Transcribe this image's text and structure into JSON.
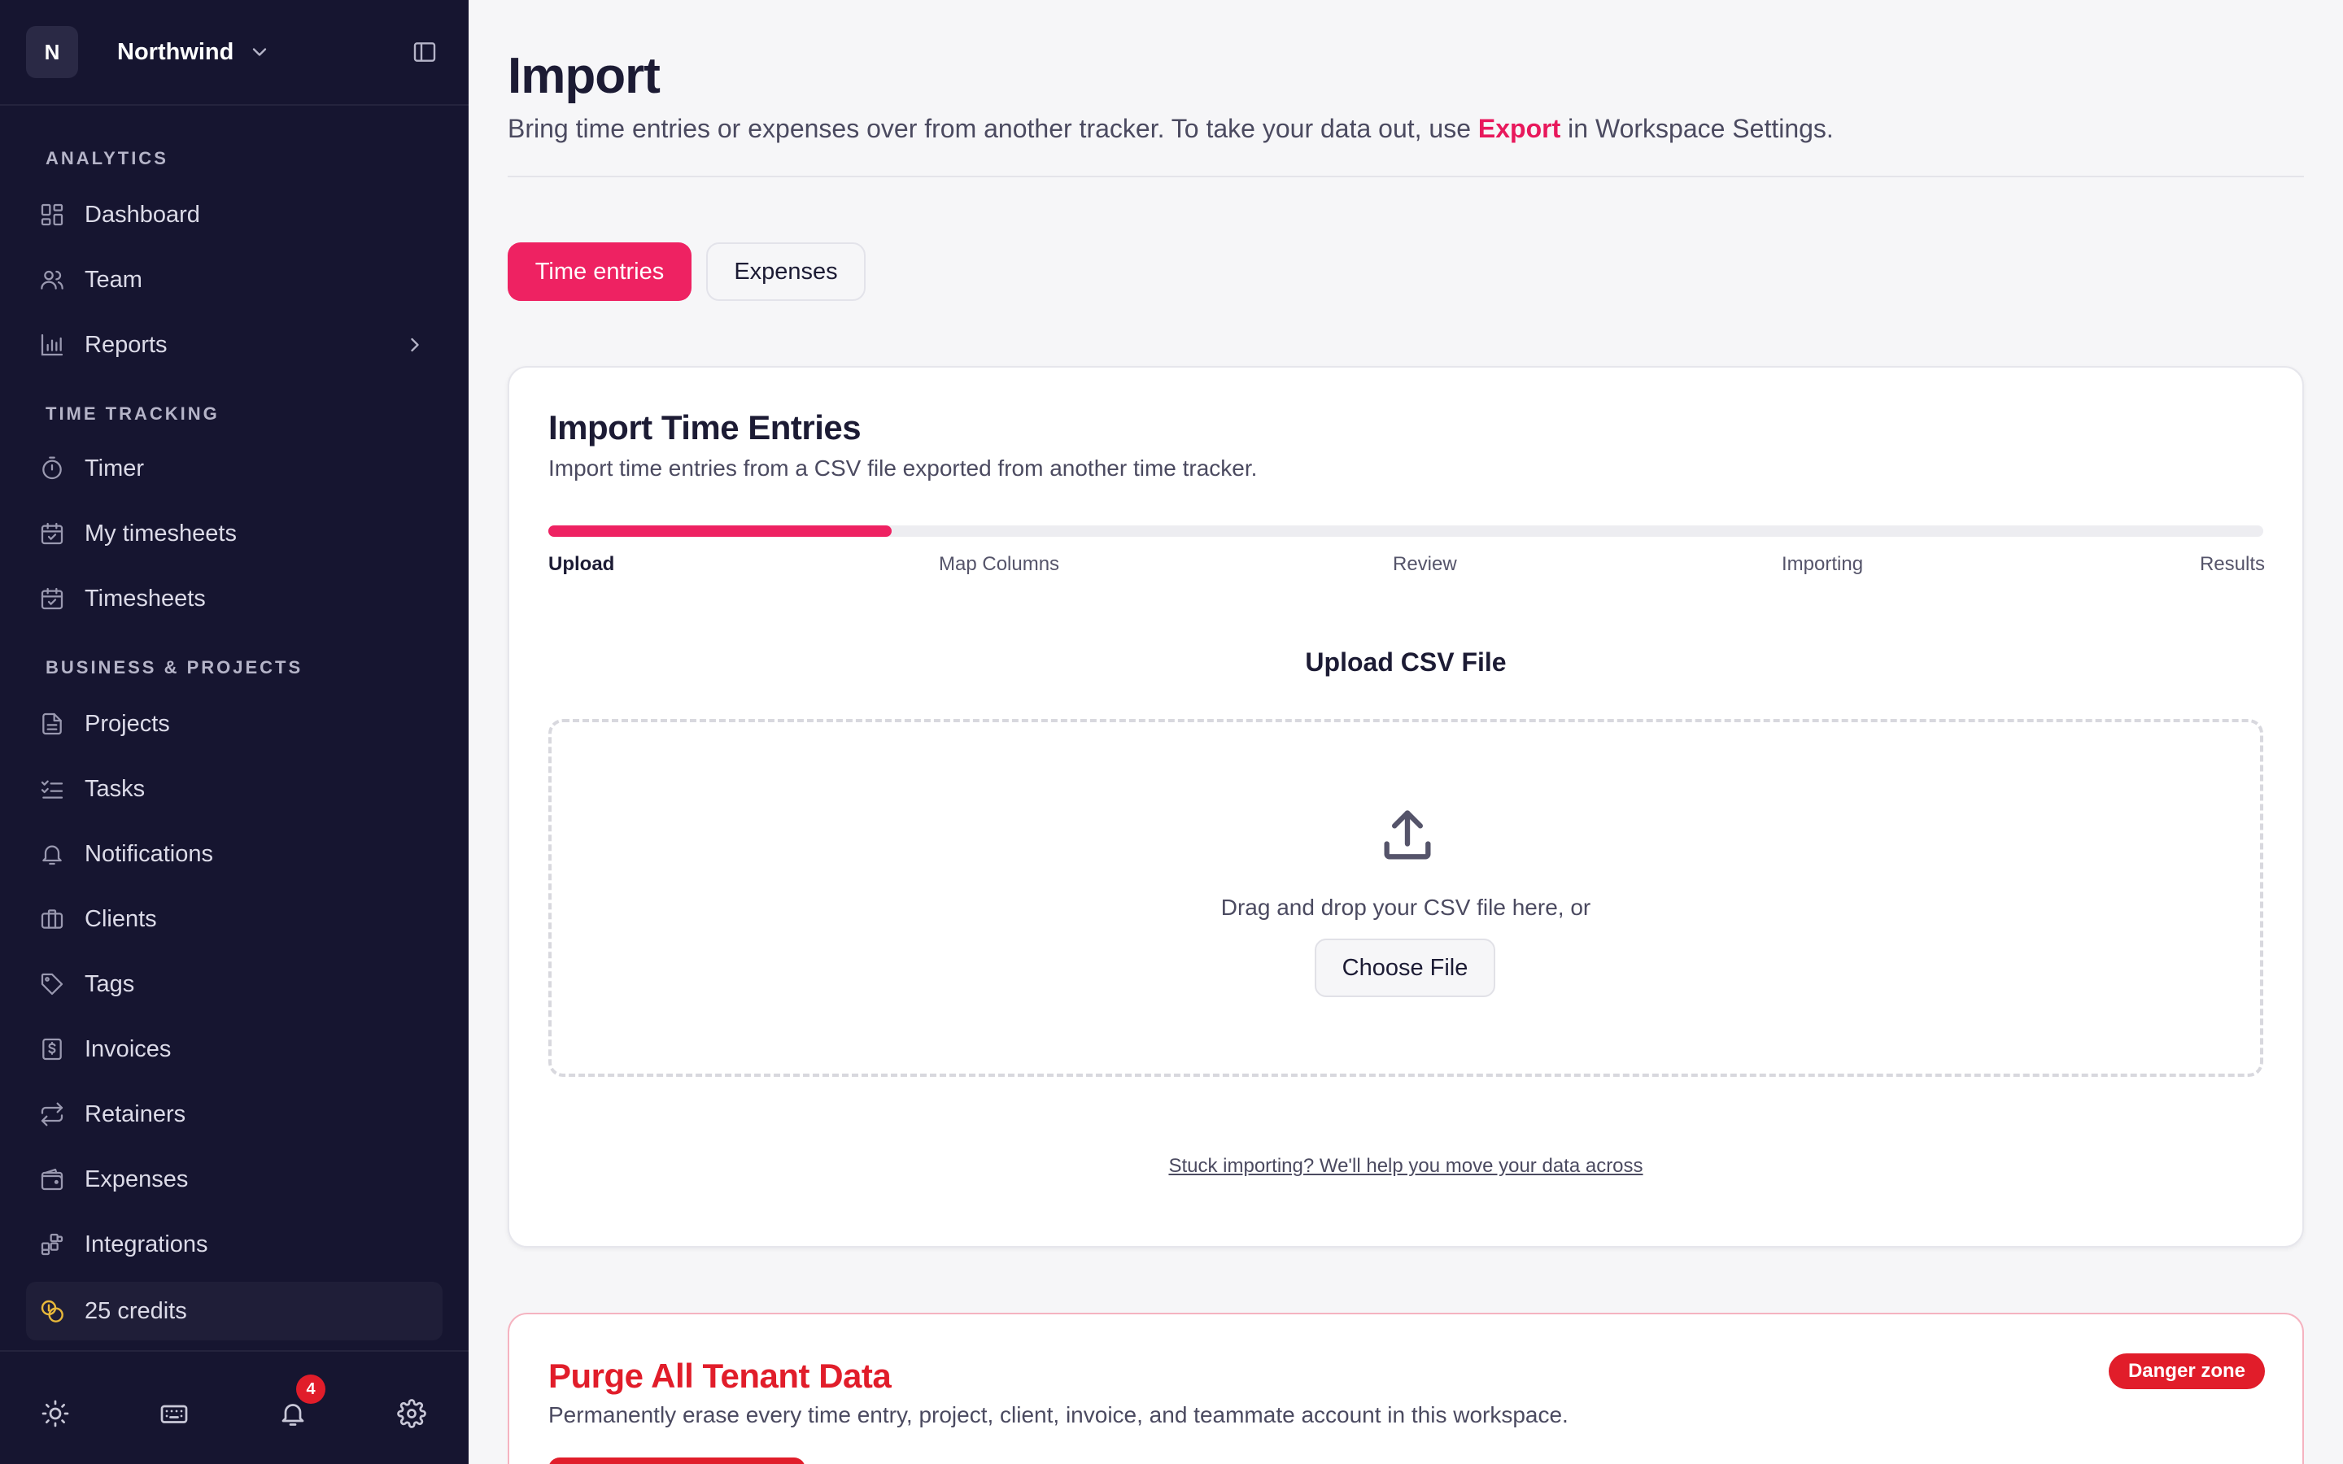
{
  "workspace": {
    "initial": "N",
    "name": "Northwind"
  },
  "sidebar": {
    "sections": {
      "analytics": "ANALYTICS",
      "time_tracking": "TIME TRACKING",
      "business": "BUSINESS & PROJECTS"
    },
    "items": {
      "dashboard": "Dashboard",
      "team": "Team",
      "reports": "Reports",
      "timer": "Timer",
      "my_timesheets": "My timesheets",
      "timesheets": "Timesheets",
      "projects": "Projects",
      "tasks": "Tasks",
      "notifications": "Notifications",
      "clients": "Clients",
      "tags": "Tags",
      "invoices": "Invoices",
      "retainers": "Retainers",
      "expenses": "Expenses",
      "integrations": "Integrations",
      "credits": "25 credits"
    },
    "notification_count": "4"
  },
  "page": {
    "title": "Import",
    "desc_before": "Bring time entries or expenses over from another tracker. To take your data out, use ",
    "desc_link": "Export",
    "desc_after": " in Workspace Settings."
  },
  "tabs": {
    "time_entries": "Time entries",
    "expenses": "Expenses"
  },
  "import_card": {
    "title": "Import Time Entries",
    "description": "Import time entries from a CSV file exported from another time tracker.",
    "progress": 0.2,
    "steps": [
      "Upload",
      "Map Columns",
      "Review",
      "Importing",
      "Results"
    ],
    "upload_title": "Upload CSV File",
    "drop_text": "Drag and drop your CSV file here, or",
    "choose_button": "Choose File",
    "help_link": "Stuck importing? We'll help you move your data across"
  },
  "danger_card": {
    "title": "Purge All Tenant Data",
    "badge": "Danger zone",
    "description": "Permanently erase every time entry, project, client, invoice, and teammate account in this workspace."
  },
  "colors": {
    "accent": "#ee2262",
    "sidebar_bg": "#161530",
    "danger": "#e11d2a",
    "credits_icon": "#e8b83a"
  }
}
